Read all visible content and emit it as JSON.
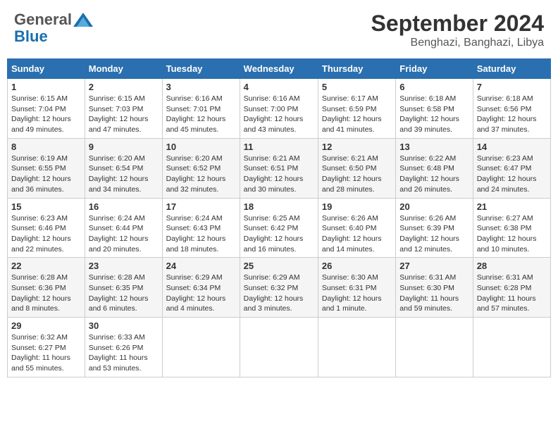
{
  "header": {
    "logo_general": "General",
    "logo_blue": "Blue",
    "month": "September 2024",
    "location": "Benghazi, Banghazi, Libya"
  },
  "days_of_week": [
    "Sunday",
    "Monday",
    "Tuesday",
    "Wednesday",
    "Thursday",
    "Friday",
    "Saturday"
  ],
  "weeks": [
    [
      {
        "day": "1",
        "sunrise": "Sunrise: 6:15 AM",
        "sunset": "Sunset: 7:04 PM",
        "daylight": "Daylight: 12 hours and 49 minutes."
      },
      {
        "day": "2",
        "sunrise": "Sunrise: 6:15 AM",
        "sunset": "Sunset: 7:03 PM",
        "daylight": "Daylight: 12 hours and 47 minutes."
      },
      {
        "day": "3",
        "sunrise": "Sunrise: 6:16 AM",
        "sunset": "Sunset: 7:01 PM",
        "daylight": "Daylight: 12 hours and 45 minutes."
      },
      {
        "day": "4",
        "sunrise": "Sunrise: 6:16 AM",
        "sunset": "Sunset: 7:00 PM",
        "daylight": "Daylight: 12 hours and 43 minutes."
      },
      {
        "day": "5",
        "sunrise": "Sunrise: 6:17 AM",
        "sunset": "Sunset: 6:59 PM",
        "daylight": "Daylight: 12 hours and 41 minutes."
      },
      {
        "day": "6",
        "sunrise": "Sunrise: 6:18 AM",
        "sunset": "Sunset: 6:58 PM",
        "daylight": "Daylight: 12 hours and 39 minutes."
      },
      {
        "day": "7",
        "sunrise": "Sunrise: 6:18 AM",
        "sunset": "Sunset: 6:56 PM",
        "daylight": "Daylight: 12 hours and 37 minutes."
      }
    ],
    [
      {
        "day": "8",
        "sunrise": "Sunrise: 6:19 AM",
        "sunset": "Sunset: 6:55 PM",
        "daylight": "Daylight: 12 hours and 36 minutes."
      },
      {
        "day": "9",
        "sunrise": "Sunrise: 6:20 AM",
        "sunset": "Sunset: 6:54 PM",
        "daylight": "Daylight: 12 hours and 34 minutes."
      },
      {
        "day": "10",
        "sunrise": "Sunrise: 6:20 AM",
        "sunset": "Sunset: 6:52 PM",
        "daylight": "Daylight: 12 hours and 32 minutes."
      },
      {
        "day": "11",
        "sunrise": "Sunrise: 6:21 AM",
        "sunset": "Sunset: 6:51 PM",
        "daylight": "Daylight: 12 hours and 30 minutes."
      },
      {
        "day": "12",
        "sunrise": "Sunrise: 6:21 AM",
        "sunset": "Sunset: 6:50 PM",
        "daylight": "Daylight: 12 hours and 28 minutes."
      },
      {
        "day": "13",
        "sunrise": "Sunrise: 6:22 AM",
        "sunset": "Sunset: 6:48 PM",
        "daylight": "Daylight: 12 hours and 26 minutes."
      },
      {
        "day": "14",
        "sunrise": "Sunrise: 6:23 AM",
        "sunset": "Sunset: 6:47 PM",
        "daylight": "Daylight: 12 hours and 24 minutes."
      }
    ],
    [
      {
        "day": "15",
        "sunrise": "Sunrise: 6:23 AM",
        "sunset": "Sunset: 6:46 PM",
        "daylight": "Daylight: 12 hours and 22 minutes."
      },
      {
        "day": "16",
        "sunrise": "Sunrise: 6:24 AM",
        "sunset": "Sunset: 6:44 PM",
        "daylight": "Daylight: 12 hours and 20 minutes."
      },
      {
        "day": "17",
        "sunrise": "Sunrise: 6:24 AM",
        "sunset": "Sunset: 6:43 PM",
        "daylight": "Daylight: 12 hours and 18 minutes."
      },
      {
        "day": "18",
        "sunrise": "Sunrise: 6:25 AM",
        "sunset": "Sunset: 6:42 PM",
        "daylight": "Daylight: 12 hours and 16 minutes."
      },
      {
        "day": "19",
        "sunrise": "Sunrise: 6:26 AM",
        "sunset": "Sunset: 6:40 PM",
        "daylight": "Daylight: 12 hours and 14 minutes."
      },
      {
        "day": "20",
        "sunrise": "Sunrise: 6:26 AM",
        "sunset": "Sunset: 6:39 PM",
        "daylight": "Daylight: 12 hours and 12 minutes."
      },
      {
        "day": "21",
        "sunrise": "Sunrise: 6:27 AM",
        "sunset": "Sunset: 6:38 PM",
        "daylight": "Daylight: 12 hours and 10 minutes."
      }
    ],
    [
      {
        "day": "22",
        "sunrise": "Sunrise: 6:28 AM",
        "sunset": "Sunset: 6:36 PM",
        "daylight": "Daylight: 12 hours and 8 minutes."
      },
      {
        "day": "23",
        "sunrise": "Sunrise: 6:28 AM",
        "sunset": "Sunset: 6:35 PM",
        "daylight": "Daylight: 12 hours and 6 minutes."
      },
      {
        "day": "24",
        "sunrise": "Sunrise: 6:29 AM",
        "sunset": "Sunset: 6:34 PM",
        "daylight": "Daylight: 12 hours and 4 minutes."
      },
      {
        "day": "25",
        "sunrise": "Sunrise: 6:29 AM",
        "sunset": "Sunset: 6:32 PM",
        "daylight": "Daylight: 12 hours and 3 minutes."
      },
      {
        "day": "26",
        "sunrise": "Sunrise: 6:30 AM",
        "sunset": "Sunset: 6:31 PM",
        "daylight": "Daylight: 12 hours and 1 minute."
      },
      {
        "day": "27",
        "sunrise": "Sunrise: 6:31 AM",
        "sunset": "Sunset: 6:30 PM",
        "daylight": "Daylight: 11 hours and 59 minutes."
      },
      {
        "day": "28",
        "sunrise": "Sunrise: 6:31 AM",
        "sunset": "Sunset: 6:28 PM",
        "daylight": "Daylight: 11 hours and 57 minutes."
      }
    ],
    [
      {
        "day": "29",
        "sunrise": "Sunrise: 6:32 AM",
        "sunset": "Sunset: 6:27 PM",
        "daylight": "Daylight: 11 hours and 55 minutes."
      },
      {
        "day": "30",
        "sunrise": "Sunrise: 6:33 AM",
        "sunset": "Sunset: 6:26 PM",
        "daylight": "Daylight: 11 hours and 53 minutes."
      },
      null,
      null,
      null,
      null,
      null
    ]
  ]
}
